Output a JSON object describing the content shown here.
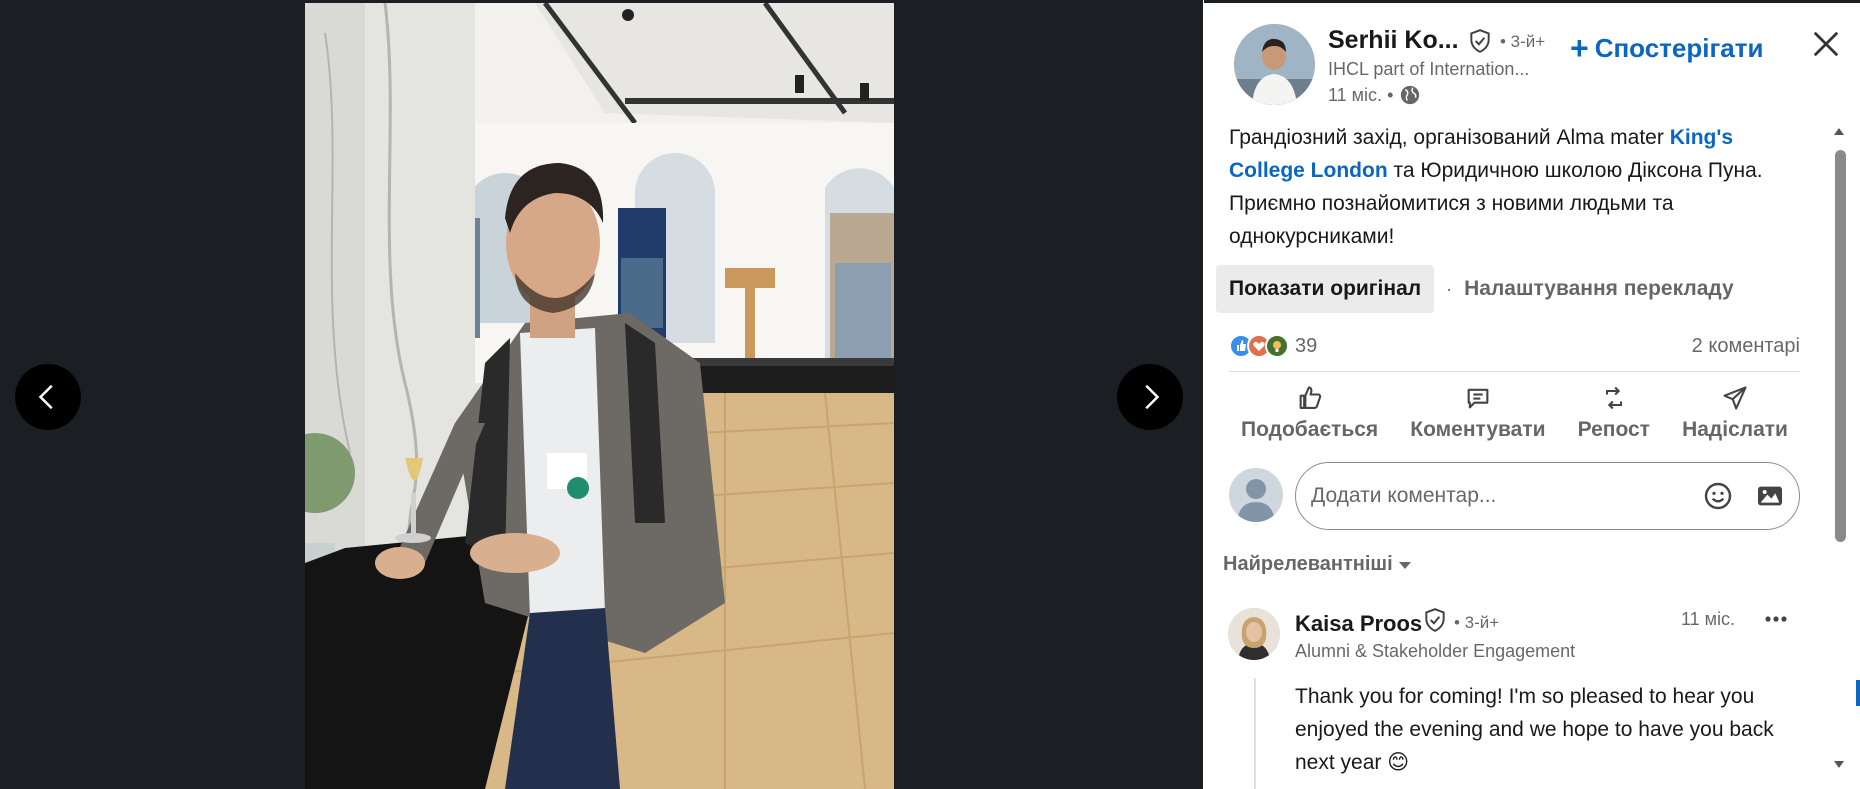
{
  "viewer": {
    "prev_label": "Previous",
    "next_label": "Next"
  },
  "author": {
    "name": "Serhii Ko...",
    "degree": "• 3-й+",
    "headline": "IHCL part of Internation...",
    "time": "11 міс. •",
    "follow_label": "Спостерігати"
  },
  "post": {
    "text_1": "Грандіозний захід, організований Alma mater ",
    "link": "King's College London",
    "text_2": " та Юридичною школою Діксона Пуна. Приємно познайомитися з новими людьми та однокурсниками!"
  },
  "translation": {
    "show_original": "Показати оригінал",
    "separator": "·",
    "settings": "Налаштування перекладу"
  },
  "social": {
    "reaction_count": "39",
    "comments_count": "2 коментарі"
  },
  "actions": {
    "like": "Подобається",
    "comment": "Коментувати",
    "repost": "Репост",
    "send": "Надіслати"
  },
  "comment_box": {
    "placeholder": "Додати коментар..."
  },
  "sort": {
    "label": "Найрелевантніші"
  },
  "comment": {
    "name": "Kaisa Proos",
    "degree": "• 3-й+",
    "headline": "Alumni & Stakeholder Engagement",
    "time": "11 міс.",
    "text": "Thank you for coming! I'm so pleased to hear you enjoyed the evening and we hope to have you back next year 😊"
  },
  "colors": {
    "brand_blue": "#0a66c2",
    "viewer_bg": "#1b1f23",
    "like_blue": "#378fe9",
    "love_red": "#df704d",
    "insight_green": "#44712e"
  },
  "icons": {
    "verified": "shield-check-icon",
    "globe": "globe-icon",
    "close": "close-icon",
    "like": "thumbs-up-icon",
    "comment": "comment-icon",
    "repost": "repost-icon",
    "send": "send-icon",
    "emoji": "emoji-icon",
    "image": "image-icon",
    "more": "more-horizontal-icon"
  }
}
